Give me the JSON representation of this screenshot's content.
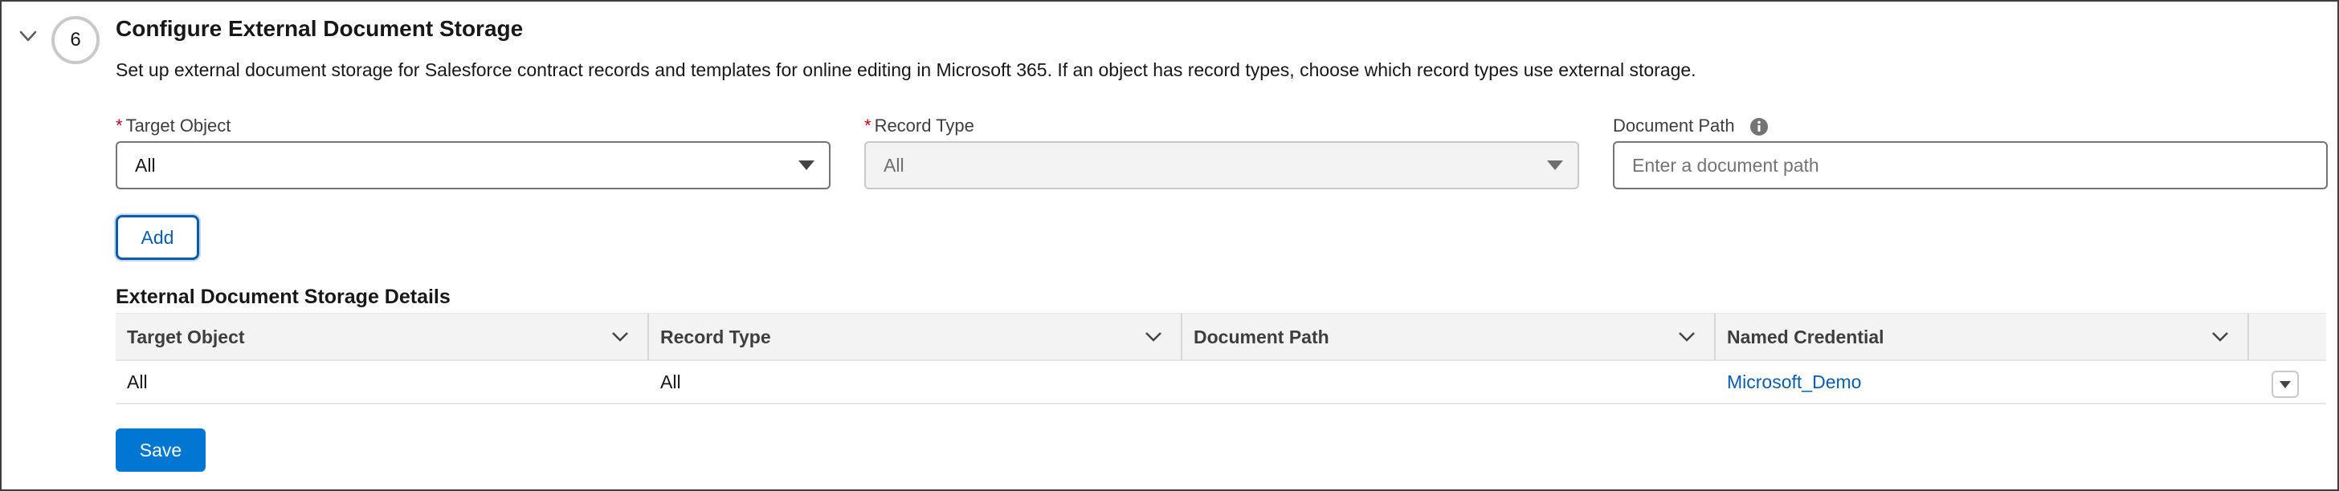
{
  "step": {
    "number": "6",
    "title": "Configure External Document Storage",
    "description": "Set up external document storage for Salesforce contract records and templates for online editing in Microsoft 365. If an object has record types, choose which record types use external storage."
  },
  "form": {
    "target_object": {
      "label": "Target Object",
      "required_mark": "*",
      "value": "All"
    },
    "record_type": {
      "label": "Record Type",
      "required_mark": "*",
      "value": "All",
      "disabled": true
    },
    "document_path": {
      "label": "Document Path",
      "placeholder": "Enter a document path",
      "value": ""
    },
    "add_label": "Add"
  },
  "details": {
    "title": "External Document Storage Details",
    "columns": [
      "Target Object",
      "Record Type",
      "Document Path",
      "Named Credential"
    ],
    "rows": [
      {
        "target_object": "All",
        "record_type": "All",
        "document_path": "",
        "named_credential": "Microsoft_Demo"
      }
    ]
  },
  "save_label": "Save",
  "colors": {
    "brand": "#0176d3",
    "link": "#0b5cab",
    "required": "#ba0517"
  }
}
